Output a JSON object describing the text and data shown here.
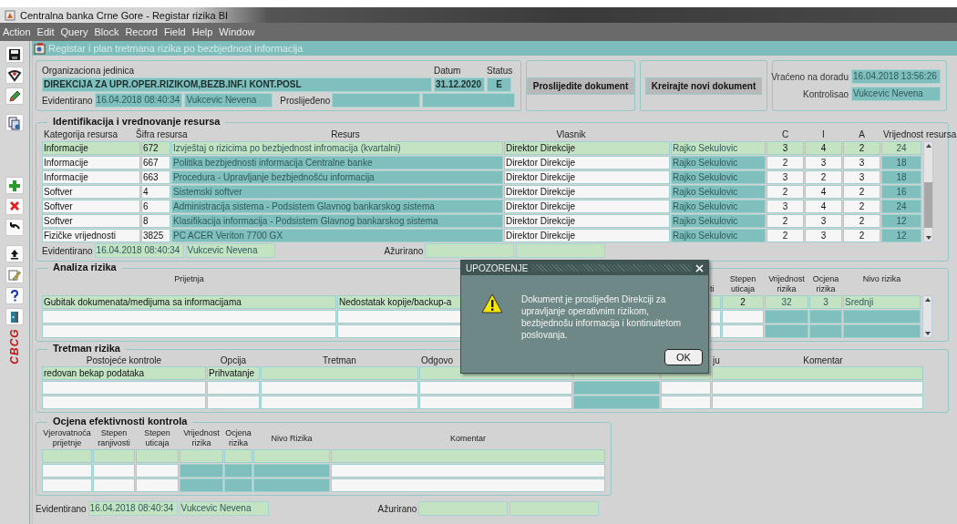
{
  "window": {
    "title": "Centralna banka Crne Gore - Registar rizika BI"
  },
  "menu": [
    "Action",
    "Edit",
    "Query",
    "Block",
    "Record",
    "Field",
    "Help",
    "Window"
  ],
  "sidebar": {
    "logo": "CBCG"
  },
  "form": {
    "title": "Registar i plan tretmana rizika po bezbjednost informacija"
  },
  "header": {
    "org_label": "Organizaciona jedinica",
    "org_value": "DIREKCIJA ZA UPR.OPER.RIZIKOM,BEZB.INF.I KONT.POSL",
    "date_label": "Datum",
    "date_value": "31.12.2020",
    "status_label": "Status",
    "status_value": "E",
    "recorded_label": "Evidentirano",
    "recorded_date": "16.04.2018 08:40:34",
    "recorded_by": "Vukcevic Nevena",
    "forwarded_label": "Proslijeđeno"
  },
  "actions": [
    {
      "label": "Proslijedite dokument"
    },
    {
      "label": "Kreirajte novi dokument"
    }
  ],
  "review": {
    "returned_label": "Vraćeno na doradu",
    "returned_value": "16.04.2018 13:56:26",
    "controlled_label": "Kontrolisao",
    "controlled_value": "Vukcevic Nevena"
  },
  "sections": [
    {
      "title": "Identifikacija i vrednovanje resursa",
      "kind": "resources",
      "scrollbar": true,
      "columns": [
        {
          "header": "Kategorija resursa",
          "kind": "input"
        },
        {
          "header": "Šifra resursa",
          "kind": "input"
        },
        {
          "header": "Resurs",
          "kind": "display"
        },
        {
          "header": "Vlasnik",
          "kind": "input"
        },
        {
          "kind": "display"
        },
        {
          "header": "C",
          "kind": "input"
        },
        {
          "header": "I",
          "kind": "input"
        },
        {
          "header": "A",
          "kind": "input"
        },
        {
          "header": "Vrijednost resursa",
          "kind": "display"
        }
      ],
      "rows": [
        {
          "selected": true,
          "cells": [
            "Informacije",
            "672",
            "Izvještaj o rizicima po bezbjednost infromacija (kvartalni)",
            "Direktor Direkcije",
            "Rajko Sekulovic",
            "3",
            "4",
            "2",
            "24"
          ]
        },
        {
          "selected": false,
          "cells": [
            "Informacije",
            "667",
            "Politika bezbjednosti informacija Centralne banke",
            "Direktor Direkcije",
            "Rajko Sekulovic",
            "2",
            "3",
            "3",
            "18"
          ]
        },
        {
          "selected": false,
          "cells": [
            "Informacije",
            "663",
            "Procedura - Upravljanje bezbjednošću informacija",
            "Direktor Direkcije",
            "Rajko Sekulovic",
            "3",
            "2",
            "3",
            "18"
          ]
        },
        {
          "selected": false,
          "cells": [
            "Softver",
            "4",
            "Sistemski softver",
            "Direktor Direkcije",
            "Rajko Sekulovic",
            "2",
            "4",
            "2",
            "16"
          ]
        },
        {
          "selected": false,
          "cells": [
            "Softver",
            "6",
            "Administracija sistema - Podsistem Glavnog bankarskog sistema",
            "Direktor Direkcije",
            "Rajko Sekulovic",
            "3",
            "4",
            "2",
            "24"
          ]
        },
        {
          "selected": false,
          "cells": [
            "Softver",
            "8",
            "Klasifikacija informacija - Podsistem Glavnog bankarskog sistema",
            "Direktor Direkcije",
            "Rajko Sekulovic",
            "2",
            "3",
            "2",
            "12"
          ]
        },
        {
          "selected": false,
          "cells": [
            "Fizičke vrijednosti",
            "3825",
            "PC ACER Veriton 7700 GX",
            "Direktor Direkcije",
            "Rajko Sekulovic",
            "2",
            "3",
            "2",
            "12"
          ]
        }
      ],
      "audit": {
        "recorded_label": "Evidentirano",
        "recorded_date": "16.04.2018 08:40:34",
        "recorded_by": "Vukcevic Nevena",
        "updated_label": "Ažurirano"
      }
    },
    {
      "title": "Analiza rizika",
      "kind": "analysis",
      "scrollbar": true,
      "columns": [
        {
          "header": "Prijetnja",
          "kind": "input"
        },
        {
          "kind": "input"
        },
        {
          "kind": "input"
        },
        {
          "kind": "input"
        },
        {
          "header": "ti",
          "kind": "input"
        },
        {
          "header": "Stepen\nuticaja",
          "kind": "input"
        },
        {
          "header": "Vrijednost\nrizika",
          "kind": "display"
        },
        {
          "header": "Ocjena\nrizika",
          "kind": "display"
        },
        {
          "header": "Nivo rizika",
          "kind": "display"
        }
      ],
      "rows": [
        {
          "selected": true,
          "cells": [
            "Gubitak dokumenata/medijuma sa informacijama",
            "Nedostatak kopije/backup-a",
            null,
            null,
            null,
            "2",
            "32",
            "3",
            "Srednji"
          ]
        },
        {
          "selected": false
        },
        {
          "selected": false
        }
      ]
    },
    {
      "title": "Tretman rizika",
      "kind": "treatment",
      "scrollbar": false,
      "columns": [
        {
          "header": "Postojeće kontrole",
          "kind": "input"
        },
        {
          "header": "Opcija",
          "kind": "input"
        },
        {
          "header": "Tretman",
          "kind": "input"
        },
        {
          "header": "Odgovo",
          "kind": "input"
        },
        {
          "kind": "display"
        },
        {
          "header": "ju",
          "kind": "input"
        },
        {
          "header": "Komentar",
          "kind": "input"
        }
      ],
      "rows": [
        {
          "selected": true,
          "cells": [
            "redovan bekap podataka",
            "Prihvatanje",
            null,
            null,
            null,
            null,
            null
          ]
        },
        {
          "selected": false
        },
        {
          "selected": false
        }
      ]
    },
    {
      "title": "Ocjena efektivnosti kontrola",
      "kind": "effectiveness",
      "scrollbar": false,
      "columns": [
        {
          "header": "Vjerovatnoća\nprijetnje",
          "kind": "input"
        },
        {
          "header": "Stepen\nranjivosti",
          "kind": "input"
        },
        {
          "header": "Stepen\nuticaja",
          "kind": "input"
        },
        {
          "header": "Vrijednost\nrizika",
          "kind": "display"
        },
        {
          "header": "Ocjena\nrizika",
          "kind": "display"
        },
        {
          "header": "Nivo Rizika",
          "kind": "display"
        },
        {
          "header": "Komentar",
          "kind": "input"
        }
      ],
      "rows": [
        {
          "selected": true
        },
        {
          "selected": false
        },
        {
          "selected": false
        }
      ]
    }
  ],
  "footer": {
    "recorded_label": "Evidentirano",
    "recorded_date": "16.04.2018 08:40:34",
    "recorded_by": "Vukcevic Nevena",
    "updated_label": "Ažurirano"
  },
  "dialog": {
    "title": "UPOZORENJE",
    "message": "Dokument je proslijeđen Direkciji za upravljanje operativnim rizikom, bezbjednošu informacija i kontinuitetom poslovanja.",
    "button": "OK"
  }
}
